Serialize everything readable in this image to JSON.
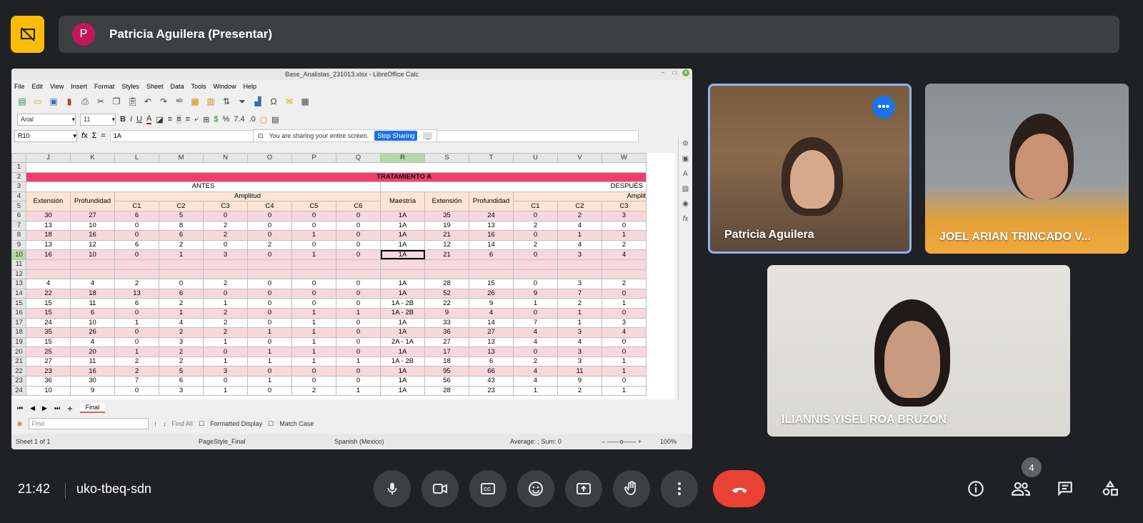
{
  "presenter": {
    "avatar_letter": "P",
    "label": "Patricia Aguilera (Presentar)"
  },
  "window": {
    "title": "Base_Analistas_231013.xlsx - LibreOffice Calc",
    "menu": [
      "File",
      "Edit",
      "View",
      "Insert",
      "Format",
      "Styles",
      "Sheet",
      "Data",
      "Tools",
      "Window",
      "Help"
    ],
    "font_name": "Arial",
    "font_size": "11",
    "cell_ref": "R10",
    "formula": "1A",
    "share_note": "You are sharing your entire screen.",
    "stop_sharing": "Stop Sharing"
  },
  "sheet": {
    "columns": [
      "J",
      "K",
      "L",
      "M",
      "N",
      "O",
      "P",
      "Q",
      "R",
      "S",
      "T",
      "U",
      "V",
      "W"
    ],
    "title": "TRATAMIENTO A",
    "antes": "ANTES",
    "despues": "DESPUÉS",
    "amplitud": "Amplitud",
    "amplitud2": "Amplit",
    "h_extension": "Extensión",
    "h_profundidad": "Profundidad",
    "h_maestria": "Maestría",
    "sub": [
      "C1",
      "C2",
      "C3",
      "C4",
      "C5",
      "C6"
    ],
    "sub2": [
      "C1",
      "C2",
      "C3"
    ],
    "rows": [
      {
        "n": "6",
        "v": [
          "30",
          "27",
          "6",
          "5",
          "0",
          "0",
          "0",
          "0",
          "1A",
          "35",
          "24",
          "0",
          "2",
          "3"
        ]
      },
      {
        "n": "7",
        "v": [
          "13",
          "10",
          "0",
          "8",
          "2",
          "0",
          "0",
          "0",
          "1A",
          "19",
          "13",
          "2",
          "4",
          "0"
        ]
      },
      {
        "n": "8",
        "v": [
          "18",
          "16",
          "0",
          "6",
          "2",
          "0",
          "1",
          "0",
          "1A",
          "21",
          "16",
          "0",
          "1",
          "1"
        ]
      },
      {
        "n": "9",
        "v": [
          "13",
          "12",
          "6",
          "2",
          "0",
          "2",
          "0",
          "0",
          "1A",
          "12",
          "14",
          "2",
          "4",
          "2"
        ]
      },
      {
        "n": "10",
        "v": [
          "16",
          "10",
          "0",
          "1",
          "3",
          "0",
          "1",
          "0",
          "1A",
          "21",
          "6",
          "0",
          "3",
          "4"
        ]
      },
      {
        "n": "11",
        "v": [
          "",
          "",
          "",
          "",
          "",
          "",
          "",
          "",
          "",
          "",
          "",
          "",
          "",
          ""
        ]
      },
      {
        "n": "12",
        "v": [
          "",
          "",
          "",
          "",
          "",
          "",
          "",
          "",
          "",
          "",
          "",
          "",
          "",
          ""
        ]
      },
      {
        "n": "13",
        "v": [
          "4",
          "4",
          "2",
          "0",
          "2",
          "0",
          "0",
          "0",
          "1A",
          "28",
          "15",
          "0",
          "3",
          "2"
        ]
      },
      {
        "n": "14",
        "v": [
          "22",
          "18",
          "13",
          "6",
          "0",
          "0",
          "0",
          "0",
          "1A",
          "52",
          "26",
          "9",
          "7",
          "0"
        ]
      },
      {
        "n": "15",
        "v": [
          "15",
          "11",
          "6",
          "2",
          "1",
          "0",
          "0",
          "0",
          "1A - 2B",
          "22",
          "9",
          "1",
          "2",
          "1"
        ]
      },
      {
        "n": "16",
        "v": [
          "15",
          "6",
          "0",
          "1",
          "2",
          "0",
          "1",
          "1",
          "1A - 2B",
          "9",
          "4",
          "0",
          "1",
          "0"
        ]
      },
      {
        "n": "17",
        "v": [
          "24",
          "10",
          "1",
          "4",
          "2",
          "0",
          "1",
          "0",
          "1A",
          "33",
          "14",
          "7",
          "1",
          "3"
        ]
      },
      {
        "n": "18",
        "v": [
          "35",
          "26",
          "0",
          "2",
          "2",
          "1",
          "1",
          "0",
          "1A",
          "36",
          "27",
          "4",
          "3",
          "4"
        ]
      },
      {
        "n": "19",
        "v": [
          "15",
          "4",
          "0",
          "3",
          "1",
          "0",
          "1",
          "0",
          "2A - 1A",
          "27",
          "13",
          "4",
          "4",
          "0"
        ]
      },
      {
        "n": "20",
        "v": [
          "25",
          "20",
          "1",
          "2",
          "0",
          "1",
          "1",
          "0",
          "1A",
          "17",
          "13",
          "0",
          "3",
          "0"
        ]
      },
      {
        "n": "21",
        "v": [
          "27",
          "11",
          "2",
          "2",
          "1",
          "1",
          "1",
          "1",
          "1A - 2B",
          "18",
          "6",
          "2",
          "3",
          "1"
        ]
      },
      {
        "n": "22",
        "v": [
          "23",
          "16",
          "2",
          "5",
          "3",
          "0",
          "0",
          "0",
          "1A",
          "95",
          "66",
          "4",
          "11",
          "1"
        ]
      },
      {
        "n": "23",
        "v": [
          "36",
          "30",
          "7",
          "6",
          "0",
          "1",
          "0",
          "0",
          "1A",
          "56",
          "43",
          "4",
          "9",
          "0"
        ]
      },
      {
        "n": "24",
        "v": [
          "10",
          "9",
          "0",
          "3",
          "1",
          "0",
          "2",
          "1",
          "1A",
          "28",
          "23",
          "1",
          "2",
          "1"
        ]
      }
    ]
  },
  "tabs": {
    "active": "Final"
  },
  "find": {
    "placeholder": "Find",
    "find_all": "Find All",
    "formatted": "Formatted Display",
    "match_case": "Match Case"
  },
  "status": {
    "sheet": "Sheet 1 of 1",
    "page_style": "PageStyle_Final",
    "lang": "Spanish (Mexico)",
    "sum": "Average: ; Sum: 0",
    "zoom": "100%"
  },
  "participants": [
    {
      "name": "Patricia Aguilera"
    },
    {
      "name": "JOEL ARIAN TRINCADO V..."
    },
    {
      "name": "ILIANNIS YISEL ROA BRUZON"
    }
  ],
  "meeting": {
    "time": "21:42",
    "code": "uko-tbeq-sdn",
    "participant_count": "4"
  }
}
